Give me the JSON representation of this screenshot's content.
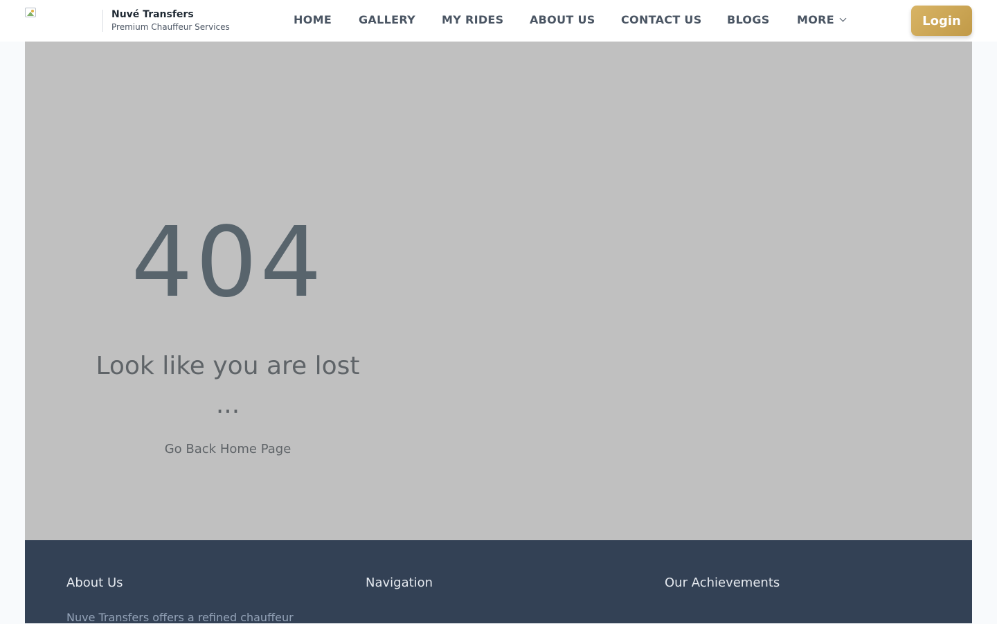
{
  "header": {
    "brand_name": "Nuvé Transfers",
    "brand_tagline": "Premium Chauffeur Services",
    "logo_icon": "broken-image-icon",
    "nav": [
      {
        "label": "HOME"
      },
      {
        "label": "GALLERY"
      },
      {
        "label": "MY RIDES"
      },
      {
        "label": "ABOUT US"
      },
      {
        "label": "CONTACT US"
      },
      {
        "label": "BLOGS"
      },
      {
        "label": "MORE"
      }
    ],
    "login_label": "Login",
    "accent_color": "#c9a552"
  },
  "main": {
    "code": "404",
    "message_line1": "Look like you are lost",
    "message_line2": "...",
    "home_link": "Go Back Home Page"
  },
  "footer": {
    "about_heading": "About Us",
    "about_text": "Nuve Transfers offers a refined chauffeur",
    "navigation_heading": "Navigation",
    "achievements_heading": "Our Achievements",
    "background_color": "#334155"
  }
}
